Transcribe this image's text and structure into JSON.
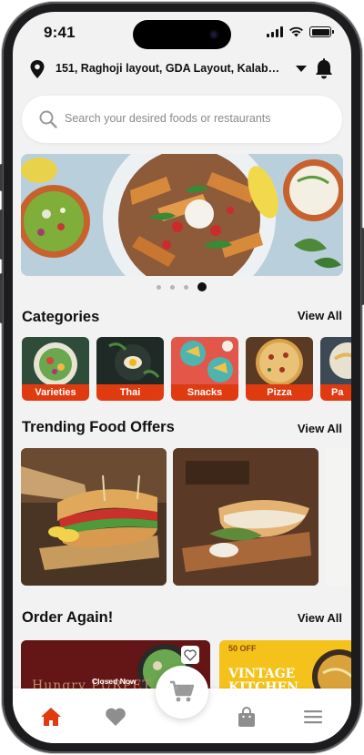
{
  "status_bar": {
    "time": "9:41"
  },
  "location": {
    "address": "151, Raghoji layout, GDA Layout, Kalaburagi, ..."
  },
  "search": {
    "placeholder": "Search your desired foods or restaurants"
  },
  "carousel": {
    "total_slides": 4,
    "active_index": 3
  },
  "categories": {
    "title": "Categories",
    "view_all": "View All",
    "items": [
      {
        "label": "Varieties"
      },
      {
        "label": "Thai"
      },
      {
        "label": "Snacks"
      },
      {
        "label": "Pizza"
      },
      {
        "label": "Pa"
      }
    ]
  },
  "trending": {
    "title": "Trending Food Offers",
    "view_all": "View All"
  },
  "order_again": {
    "title": "Order Again!",
    "view_all": "View All",
    "cards": [
      {
        "status": "Closed Now",
        "overlay_text": "Hungry PURPET"
      },
      {
        "overlay_top": "50 OFF",
        "overlay_text": "VINTAGE KITCHEN"
      }
    ]
  },
  "bottom_nav": {
    "active": "home",
    "items": [
      "home",
      "favorites",
      "orders",
      "menu"
    ]
  },
  "colors": {
    "accent": "#e03a10",
    "background": "#f2f2f2",
    "text": "#111111",
    "placeholder": "#8a8a8a"
  },
  "icons": [
    "location-pin-icon",
    "chevron-down-icon",
    "bell-icon",
    "search-icon",
    "heart-icon",
    "cart-icon",
    "home-icon",
    "bag-icon",
    "hamburger-icon"
  ]
}
